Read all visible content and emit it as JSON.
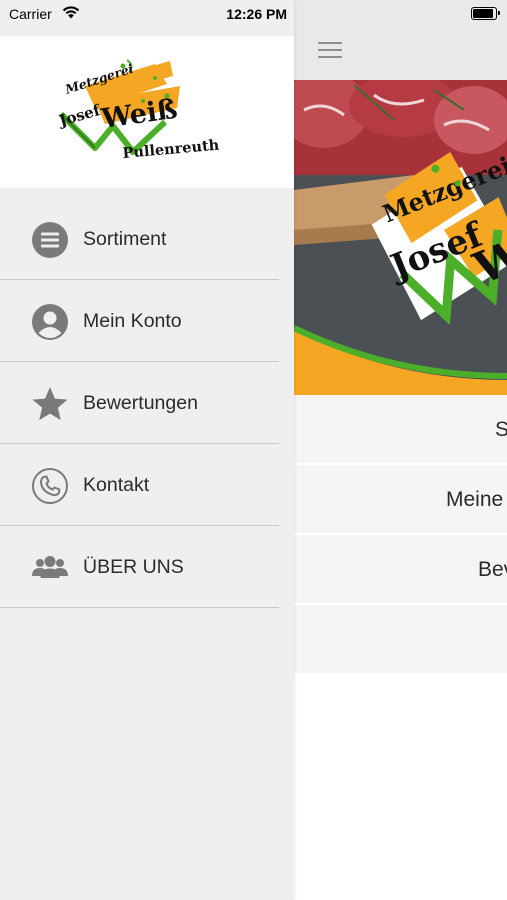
{
  "status_bar": {
    "carrier": "Carrier",
    "time": "12:26 PM"
  },
  "drawer": {
    "logo": {
      "line1": "Metzgerei",
      "line2": "Josef",
      "line3": "Weiß",
      "line4": "Pullenreuth"
    },
    "menu_items": [
      {
        "label": "Sortiment",
        "icon": "list-circle-icon"
      },
      {
        "label": "Mein Konto",
        "icon": "user-circle-icon"
      },
      {
        "label": "Bewertungen",
        "icon": "star-icon"
      },
      {
        "label": "Kontakt",
        "icon": "phone-icon"
      },
      {
        "label": "ÜBER UNS",
        "icon": "users-icon"
      }
    ]
  },
  "main": {
    "banner_text": {
      "line1": "Metzgerei",
      "line2": "Josef",
      "line3": "We"
    },
    "list_items": [
      "S",
      "Meine",
      "Bev"
    ]
  },
  "colors": {
    "brand_orange": "#f5a623",
    "brand_green": "#4caf2a",
    "icon_gray": "#7a7a7a",
    "drawer_bg": "#efefef"
  }
}
